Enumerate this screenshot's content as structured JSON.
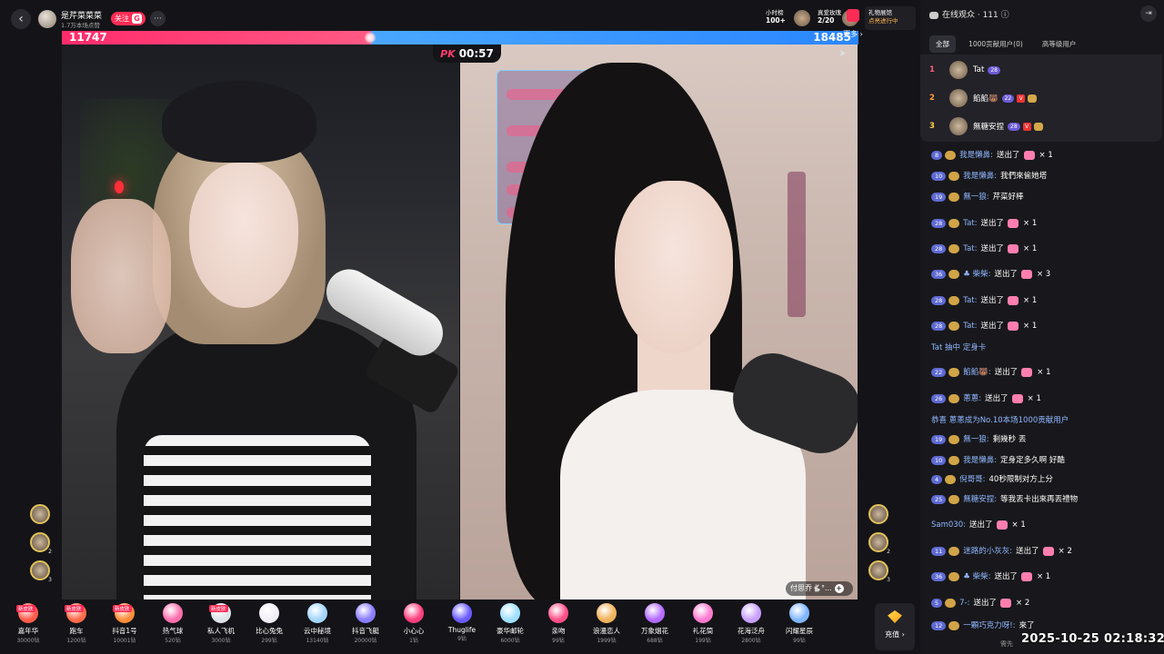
{
  "host": {
    "name": "是芹菜菜菜",
    "sub": "1.7万本场点赞",
    "follow_label": "关注",
    "follow_badge": "G",
    "more": "···",
    "back": "‹"
  },
  "ranks": [
    {
      "line1": "小时榜",
      "line2": "100+"
    },
    {
      "line1": "真爱玫瑰",
      "line2": "2/20"
    }
  ],
  "notice": {
    "line1": "礼物展馆",
    "line2": "点亮进行中"
  },
  "pk": {
    "red_score": "11747",
    "blue_score": "18485",
    "red_share": 0.388,
    "timer": "00:57",
    "logo": "PK"
  },
  "right_video_badge": "付思乔🐇°...",
  "gifts": [
    {
      "name": "嘉年华",
      "price": "30000钻",
      "tag": "新皮肤",
      "color": "#ff5b4a"
    },
    {
      "name": "跑车",
      "price": "1200钻",
      "tag": "新皮肤",
      "color": "#ff6a4a"
    },
    {
      "name": "抖音1号",
      "price": "10001钻",
      "tag": "新皮肤",
      "color": "#ff8d3a"
    },
    {
      "name": "热气球",
      "price": "520钻",
      "tag": "",
      "color": "#ff6fae"
    },
    {
      "name": "私人飞机",
      "price": "3000钻",
      "tag": "新皮肤",
      "color": "#dfe3ea"
    },
    {
      "name": "比心兔兔",
      "price": "299钻",
      "tag": "",
      "color": "#f2eef7"
    },
    {
      "name": "云中秘境",
      "price": "13140钻",
      "tag": "",
      "color": "#a4d6ff"
    },
    {
      "name": "抖音飞艇",
      "price": "20000钻",
      "tag": "",
      "color": "#8a7dff"
    },
    {
      "name": "小心心",
      "price": "1钻",
      "tag": "",
      "color": "#ff3f7e"
    },
    {
      "name": "Thuglife",
      "price": "9钻",
      "tag": "",
      "color": "#6a5cff"
    },
    {
      "name": "豪华邮轮",
      "price": "6000钻",
      "tag": "",
      "color": "#9fe0ff"
    },
    {
      "name": "亲吻",
      "price": "99钻",
      "tag": "",
      "color": "#ff4f88"
    },
    {
      "name": "浪漫恋人",
      "price": "1999钻",
      "tag": "",
      "color": "#f0b25a"
    },
    {
      "name": "万象烟花",
      "price": "688钻",
      "tag": "",
      "color": "#b46bff"
    },
    {
      "name": "礼花筒",
      "price": "199钻",
      "tag": "",
      "color": "#ff7ad1"
    },
    {
      "name": "花海泛舟",
      "price": "2800钻",
      "tag": "",
      "color": "#c9a0ff"
    },
    {
      "name": "闪耀星辰",
      "price": "99钻",
      "tag": "",
      "color": "#7fb7ff"
    }
  ],
  "gift_more": "更多",
  "recharge": "充值",
  "panel": {
    "title": "在线观众 · 111",
    "collapse": "⇥",
    "tabs": [
      "全部",
      "1000贡献用户(0)",
      "高等级用户"
    ],
    "top_users": [
      {
        "rank": "1",
        "name": "Tat",
        "level": "28"
      },
      {
        "rank": "2",
        "name": "餡餡🐻",
        "level": "22"
      },
      {
        "rank": "3",
        "name": "無糖安捏",
        "level": "28"
      }
    ]
  },
  "chat": [
    {
      "lvl": "8",
      "name": "我是懶鼻:",
      "text": "送出了",
      "gift": true,
      "qty": "× 1"
    },
    {
      "lvl": "10",
      "name": "我是懶鼻:",
      "text": "我們來偷她塔",
      "gift": false,
      "qty": ""
    },
    {
      "lvl": "19",
      "name": "無一狼:",
      "text": "芹菜好棒",
      "gift": false,
      "qty": ""
    },
    {
      "lvl": "28",
      "name": "Tat:",
      "text": "送出了",
      "gift": true,
      "qty": "× 1"
    },
    {
      "lvl": "28",
      "name": "Tat:",
      "text": "送出了",
      "gift": true,
      "qty": "× 1"
    },
    {
      "lvl": "36",
      "name": "♣ 柴柴:",
      "text": "送出了",
      "gift": true,
      "qty": "× 3"
    },
    {
      "lvl": "28",
      "name": "Tat:",
      "text": "送出了",
      "gift": true,
      "qty": "× 1"
    },
    {
      "lvl": "28",
      "name": "Tat:",
      "text": "送出了",
      "gift": true,
      "qty": "× 1"
    },
    {
      "lvl": "",
      "name": "Tat 抽中 定身卡",
      "text": "",
      "gift": false,
      "qty": ""
    },
    {
      "lvl": "22",
      "name": "餡餡🐻:",
      "text": "送出了",
      "gift": true,
      "qty": "× 1"
    },
    {
      "lvl": "26",
      "name": "蔥蔥:",
      "text": "送出了",
      "gift": true,
      "qty": "× 1"
    },
    {
      "lvl": "",
      "name": "恭喜 蔥蔥成为No.10本场1000贡献用户",
      "text": "",
      "gift": false,
      "qty": ""
    },
    {
      "lvl": "19",
      "name": "無一狼:",
      "text": "剩幾秒 丟",
      "gift": false,
      "qty": ""
    },
    {
      "lvl": "10",
      "name": "我是懶鼻:",
      "text": "定身定多久啊 好酷",
      "gift": false,
      "qty": ""
    },
    {
      "lvl": "4",
      "name": "倪哥哥:",
      "text": "40秒限制对方上分",
      "gift": false,
      "qty": ""
    },
    {
      "lvl": "25",
      "name": "無糖安捏:",
      "text": "等我丟卡出來再丟禮物",
      "gift": false,
      "qty": ""
    },
    {
      "lvl": "",
      "name": "Sam030:",
      "text": "送出了",
      "gift": true,
      "qty": "× 1"
    },
    {
      "lvl": "11",
      "name": "迷路的小灰灰:",
      "text": "送出了",
      "gift": true,
      "qty": "× 2"
    },
    {
      "lvl": "36",
      "name": "♣ 柴柴:",
      "text": "送出了",
      "gift": true,
      "qty": "× 1"
    },
    {
      "lvl": "5",
      "name": "7-:",
      "text": "送出了",
      "gift": true,
      "qty": "× 2"
    },
    {
      "lvl": "12",
      "name": "一顆巧克力呀!:",
      "text": "來了",
      "gift": false,
      "qty": ""
    }
  ],
  "timestamp": "2025-10-25 02:18:32",
  "footer_note": "需先"
}
